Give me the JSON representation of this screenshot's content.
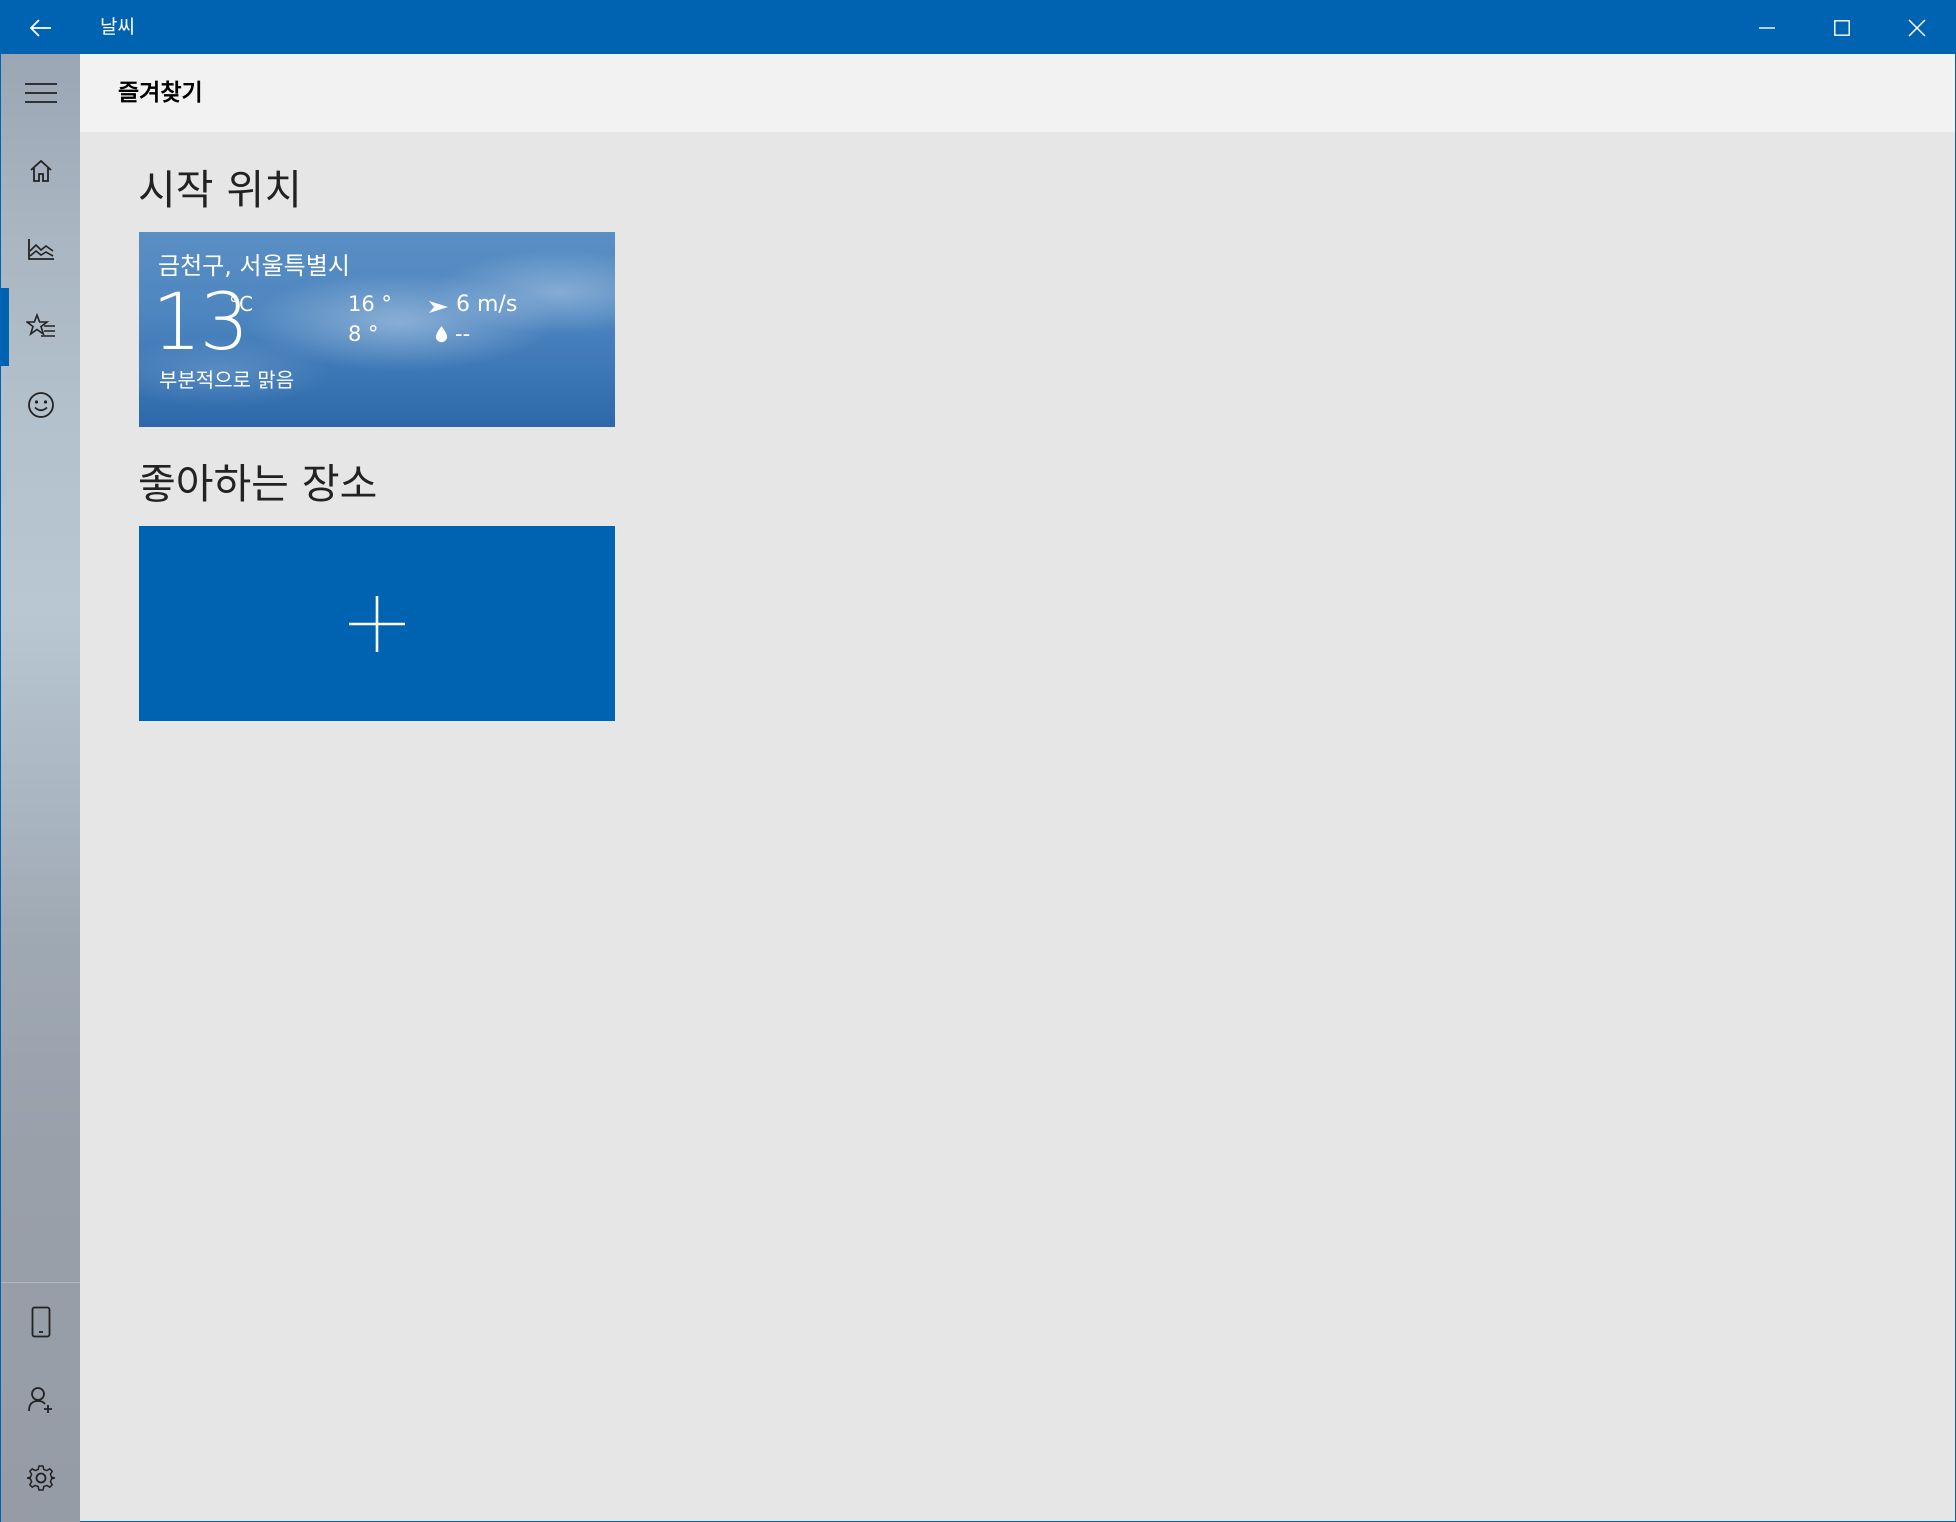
{
  "window": {
    "title": "날씨"
  },
  "header": {
    "title": "즐겨찾기"
  },
  "sidebar": {
    "items": [
      {
        "icon": "hamburger-menu-icon"
      },
      {
        "icon": "home-icon"
      },
      {
        "icon": "chart-icon"
      },
      {
        "icon": "favorites-icon",
        "selected": true
      },
      {
        "icon": "smiley-icon"
      }
    ],
    "bottom_items": [
      {
        "icon": "phone-icon"
      },
      {
        "icon": "add-person-icon"
      },
      {
        "icon": "gear-icon"
      }
    ],
    "accent_color": "#0063b1"
  },
  "launch_section": {
    "title": "시작 위치",
    "tile": {
      "city": "금천구, 서울특별시",
      "temperature": "13",
      "unit": "°C",
      "high": "16 °",
      "low": "8 °",
      "wind": "6 m/s",
      "precipitation": "--",
      "condition": "부분적으로 맑음"
    }
  },
  "favorites_section": {
    "title": "좋아하는 장소",
    "add_icon": "plus-icon"
  },
  "colors": {
    "titlebar": "#0063b1",
    "add_tile": "#0063b1",
    "content_bg": "#e6e6e6",
    "header_bg": "#f2f2f2"
  }
}
